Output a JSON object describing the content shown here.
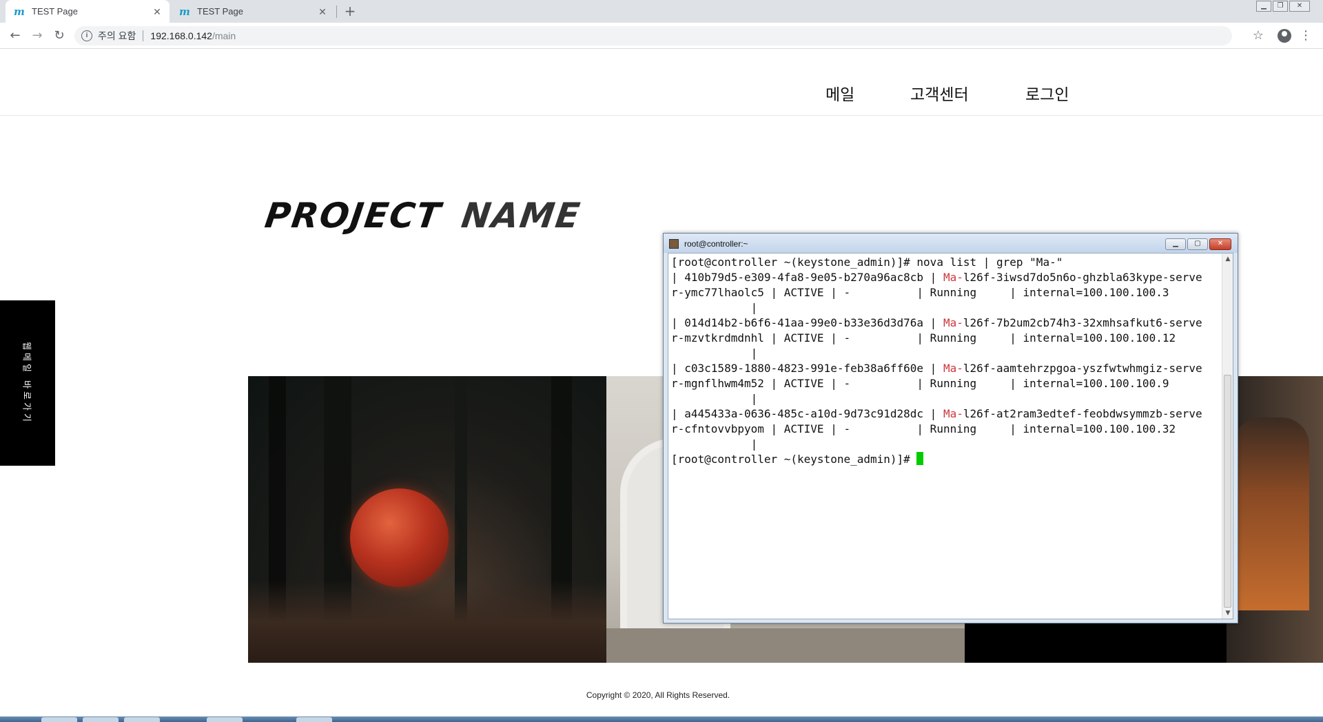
{
  "browser": {
    "tabs": [
      {
        "title": "TEST Page",
        "active": true
      },
      {
        "title": "TEST Page",
        "active": false
      }
    ],
    "address": {
      "warning": "주의 요함",
      "host": "192.168.0.142",
      "path": "/main"
    }
  },
  "page": {
    "nav": [
      "메일",
      "고객센터",
      "로그인"
    ],
    "logo": {
      "word1": "PROJECT",
      "word2": "NAME"
    },
    "sidebar_tab": "웹메일 바로가기",
    "copyright": "Copyright © 2020, All Rights Reserved."
  },
  "terminal": {
    "title": "root@controller:~",
    "prompt": "[root@controller ~(keystone_admin)]# ",
    "command": "nova list | grep \"Ma-\"",
    "rows": [
      {
        "id": "410b79d5-e309-4fa8-9e05-b270a96ac8cb",
        "prefix": "Ma-",
        "name_a": "l26f-3iwsd7do5n6o-ghzbla63kype-serve",
        "name_b": "r-ymc77lhaolc5",
        "status": "ACTIVE",
        "task": "-",
        "power": "Running",
        "network": "internal=100.100.100.3"
      },
      {
        "id": "014d14b2-b6f6-41aa-99e0-b33e36d3d76a",
        "prefix": "Ma-",
        "name_a": "l26f-7b2um2cb74h3-32xmhsafkut6-serve",
        "name_b": "r-mzvtkrdmdnhl",
        "status": "ACTIVE",
        "task": "-",
        "power": "Running",
        "network": "internal=100.100.100.12"
      },
      {
        "id": "c03c1589-1880-4823-991e-feb38a6ff60e",
        "prefix": "Ma-",
        "name_a": "l26f-aamtehrzpgoa-yszfwtwhmgiz-serve",
        "name_b": "r-mgnflhwm4m52",
        "status": "ACTIVE",
        "task": "-",
        "power": "Running",
        "network": "internal=100.100.100.9"
      },
      {
        "id": "a445433a-0636-485c-a10d-9d73c91d28dc",
        "prefix": "Ma-",
        "name_a": "l26f-at2ram3edtef-feobdwsymmzb-serve",
        "name_b": "r-cfntovvbpyom",
        "status": "ACTIVE",
        "task": "-",
        "power": "Running",
        "network": "internal=100.100.100.32"
      }
    ]
  }
}
